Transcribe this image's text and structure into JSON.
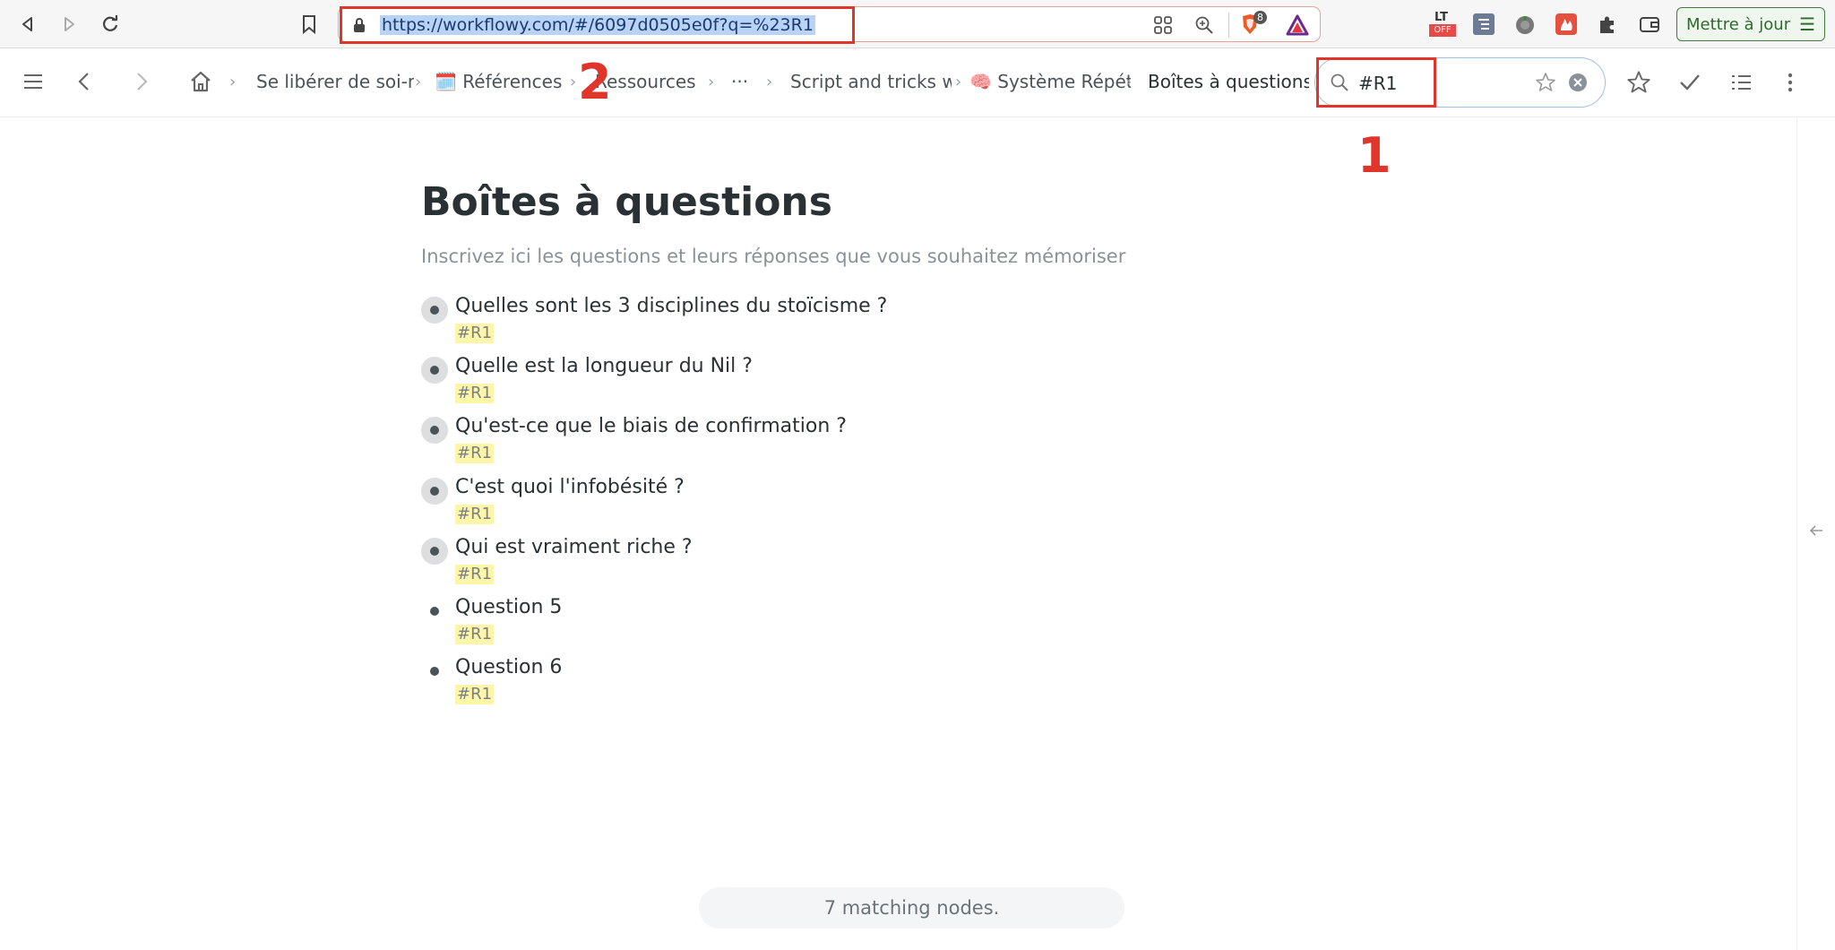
{
  "browser": {
    "url": "https://workflowy.com/#/6097d0505e0f?q=%23R1",
    "update_label": "Mettre à jour",
    "shield_count": "8",
    "lt_badge": "OFF"
  },
  "annotations": {
    "label_1": "1",
    "label_2": "2"
  },
  "breadcrumbs": [
    {
      "label": "Se libérer de soi-m"
    },
    {
      "label": "🗓️ Références"
    },
    {
      "label": "Ressources"
    },
    {
      "label": "···"
    },
    {
      "label": "Script and tricks w"
    },
    {
      "label": "🧠 Système Répéti"
    },
    {
      "label": "Boîtes à questions"
    }
  ],
  "search": {
    "value": "#R1"
  },
  "page": {
    "title": "Boîtes à questions",
    "note": "Inscrivez ici les questions et leurs réponses que vous souhaitez mémoriser"
  },
  "items": [
    {
      "text": "Quelles sont les 3 disciplines du stoïcisme ?",
      "tag": "#R1"
    },
    {
      "text": "Quelle est la longueur du Nil ?",
      "tag": "#R1"
    },
    {
      "text": "Qu'est-ce que le biais de confirmation ?",
      "tag": "#R1"
    },
    {
      "text": "C'est quoi l'infobésité ?",
      "tag": "#R1"
    },
    {
      "text": "Qui est vraiment riche ?",
      "tag": "#R1"
    },
    {
      "text": "Question 5",
      "tag": "#R1"
    },
    {
      "text": "Question 6",
      "tag": "#R1"
    }
  ],
  "status": {
    "text": "7 matching nodes."
  },
  "colors": {
    "annotation": "#e0352b",
    "tag_highlight": "#fdf6a8",
    "url_selection": "#b8d3f5"
  }
}
